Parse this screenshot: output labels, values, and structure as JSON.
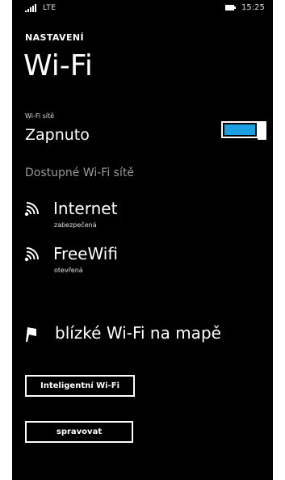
{
  "colors": {
    "background": "#000000",
    "accent": "#1ba1e2",
    "text": "#ffffff",
    "muted": "#9a9a9a",
    "brand_strip": "#e20074"
  },
  "status_bar": {
    "network_type": "LTE",
    "time": "15:25",
    "icons": [
      "signal-icon",
      "battery-icon"
    ]
  },
  "header": {
    "app_title": "NASTAVENÍ",
    "page_title": "Wi-Fi"
  },
  "wifi_toggle": {
    "caption": "Wi-Fi sítě",
    "state_label": "Zapnuto",
    "is_on": true
  },
  "available": {
    "header": "Dostupné Wi-Fi sítě",
    "networks": [
      {
        "name": "Internet",
        "status": "zabezpečená",
        "icon": "wifi-signal-icon"
      },
      {
        "name": "FreeWifi",
        "status": "otevřená",
        "icon": "wifi-signal-icon"
      }
    ]
  },
  "map_link": {
    "label": "blízké Wi-Fi na mapě",
    "icon": "map-flag-icon"
  },
  "buttons": {
    "smart_wifi": "Inteligentní Wi-Fi",
    "manage": "spravovat"
  }
}
